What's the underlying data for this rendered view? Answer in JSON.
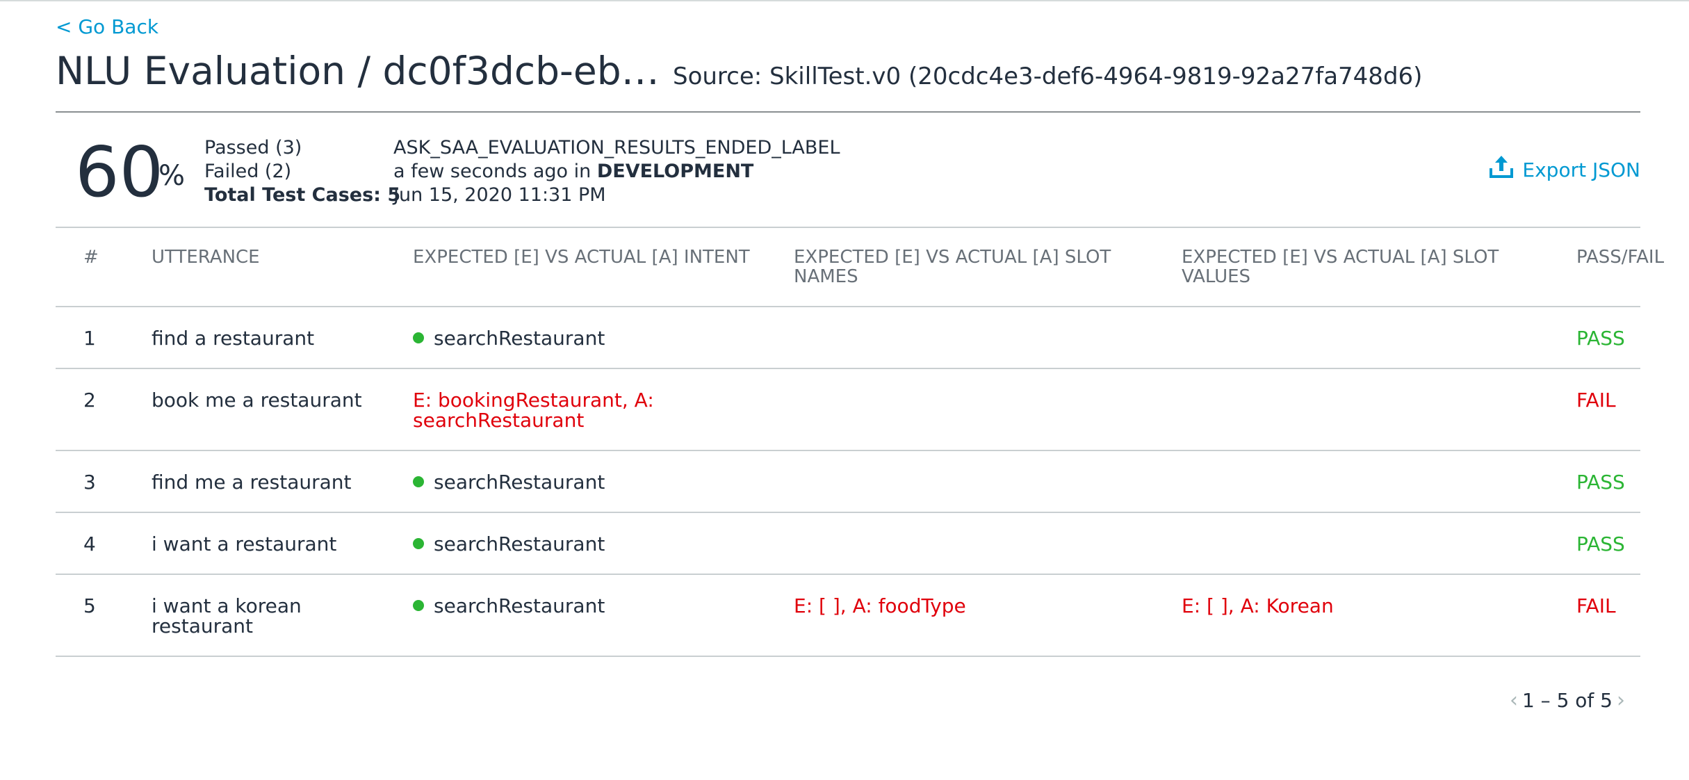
{
  "nav": {
    "go_back": "< Go Back"
  },
  "header": {
    "title": "NLU Evaluation / dc0f3dcb-eb…",
    "source": "Source: SkillTest.v0 (20cdc4e3-def6-4964-9819-92a27fa748d6)"
  },
  "summary": {
    "percent": "60",
    "percent_sign": "%",
    "passed": "Passed (3)",
    "failed": "Failed (2)",
    "total": "Total Test Cases: 5",
    "status_label": "ASK_SAA_EVALUATION_RESULTS_ENDED_LABEL",
    "when_prefix": "a few seconds ago in ",
    "stage": "DEVELOPMENT",
    "date": "Jun 15, 2020 11:31 PM",
    "export_label": "Export JSON"
  },
  "table": {
    "headers": {
      "num": "#",
      "utterance": "UTTERANCE",
      "intent": "EXPECTED [E] VS ACTUAL [A] INTENT",
      "slot_names": "EXPECTED [E] VS ACTUAL [A] SLOT NAMES",
      "slot_values": "EXPECTED [E] VS ACTUAL [A] SLOT VALUES",
      "pass_fail": "PASS/FAIL"
    },
    "rows": [
      {
        "num": "1",
        "utterance": "find a restaurant",
        "intent": "searchRestaurant",
        "intent_ok": true,
        "slot_names": "",
        "slot_values": "",
        "result": "PASS"
      },
      {
        "num": "2",
        "utterance": "book me a restaurant",
        "intent": "E: bookingRestaurant, A: searchRestaurant",
        "intent_ok": false,
        "slot_names": "",
        "slot_values": "",
        "result": "FAIL"
      },
      {
        "num": "3",
        "utterance": "find me a restaurant",
        "intent": "searchRestaurant",
        "intent_ok": true,
        "slot_names": "",
        "slot_values": "",
        "result": "PASS"
      },
      {
        "num": "4",
        "utterance": "i want a restaurant",
        "intent": "searchRestaurant",
        "intent_ok": true,
        "slot_names": "",
        "slot_values": "",
        "result": "PASS"
      },
      {
        "num": "5",
        "utterance": "i want a korean restaurant",
        "intent": "searchRestaurant",
        "intent_ok": true,
        "slot_names": "E: [ ], A: foodType",
        "slot_values": "E: [ ], A: Korean",
        "result": "FAIL"
      }
    ]
  },
  "pagination": {
    "label": "1 – 5 of 5",
    "prev_icon": "chevron-left-icon",
    "next_icon": "chevron-right-icon"
  },
  "colors": {
    "accent": "#0099d2",
    "pass": "#2bb534",
    "fail": "#e0000b",
    "text": "#232f3e"
  }
}
